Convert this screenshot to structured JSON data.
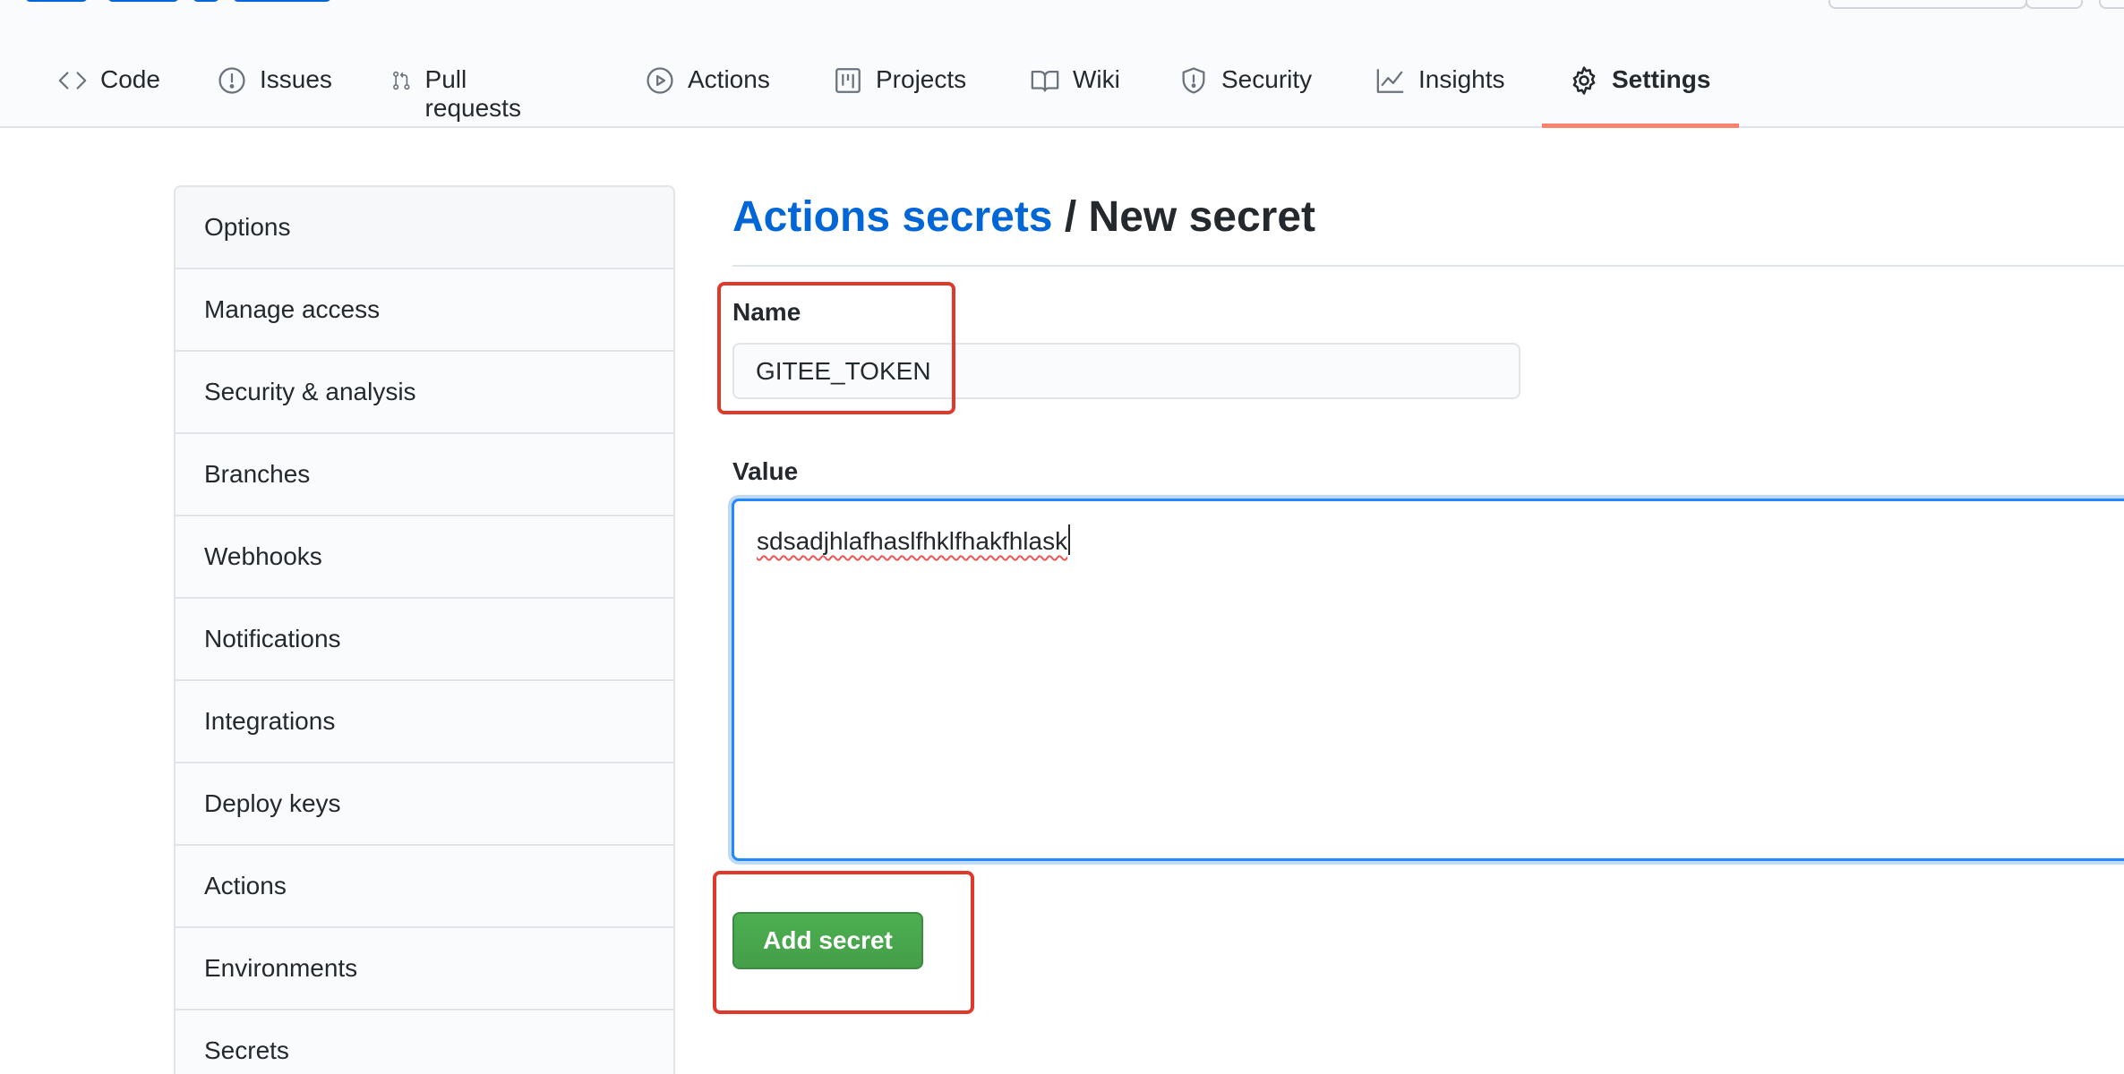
{
  "nav_tabs": [
    {
      "label": "Code",
      "icon": "code-icon"
    },
    {
      "label": "Issues",
      "icon": "issue-icon"
    },
    {
      "label": "Pull requests",
      "icon": "pull-request-icon"
    },
    {
      "label": "Actions",
      "icon": "play-icon"
    },
    {
      "label": "Projects",
      "icon": "project-icon"
    },
    {
      "label": "Wiki",
      "icon": "book-icon"
    },
    {
      "label": "Security",
      "icon": "shield-icon"
    },
    {
      "label": "Insights",
      "icon": "graph-icon"
    },
    {
      "label": "Settings",
      "icon": "gear-icon",
      "selected": true
    }
  ],
  "sidebar": {
    "items": [
      {
        "label": "Options"
      },
      {
        "label": "Manage access"
      },
      {
        "label": "Security & analysis"
      },
      {
        "label": "Branches"
      },
      {
        "label": "Webhooks"
      },
      {
        "label": "Notifications"
      },
      {
        "label": "Integrations"
      },
      {
        "label": "Deploy keys"
      },
      {
        "label": "Actions"
      },
      {
        "label": "Environments"
      },
      {
        "label": "Secrets"
      }
    ]
  },
  "page": {
    "breadcrumb_link": "Actions secrets",
    "separator": "/",
    "title": "New secret"
  },
  "form": {
    "name_label": "Name",
    "name_value": "GITEE_TOKEN",
    "value_label": "Value",
    "value_text": "sdsadjhlafhaslfhklfhakfhlask",
    "submit_label": "Add secret"
  },
  "colors": {
    "accent": "#0366d6",
    "selected_tab_underline": "#f9826c",
    "primary_button": "#2ea44f",
    "annotation": "#e0392b"
  }
}
